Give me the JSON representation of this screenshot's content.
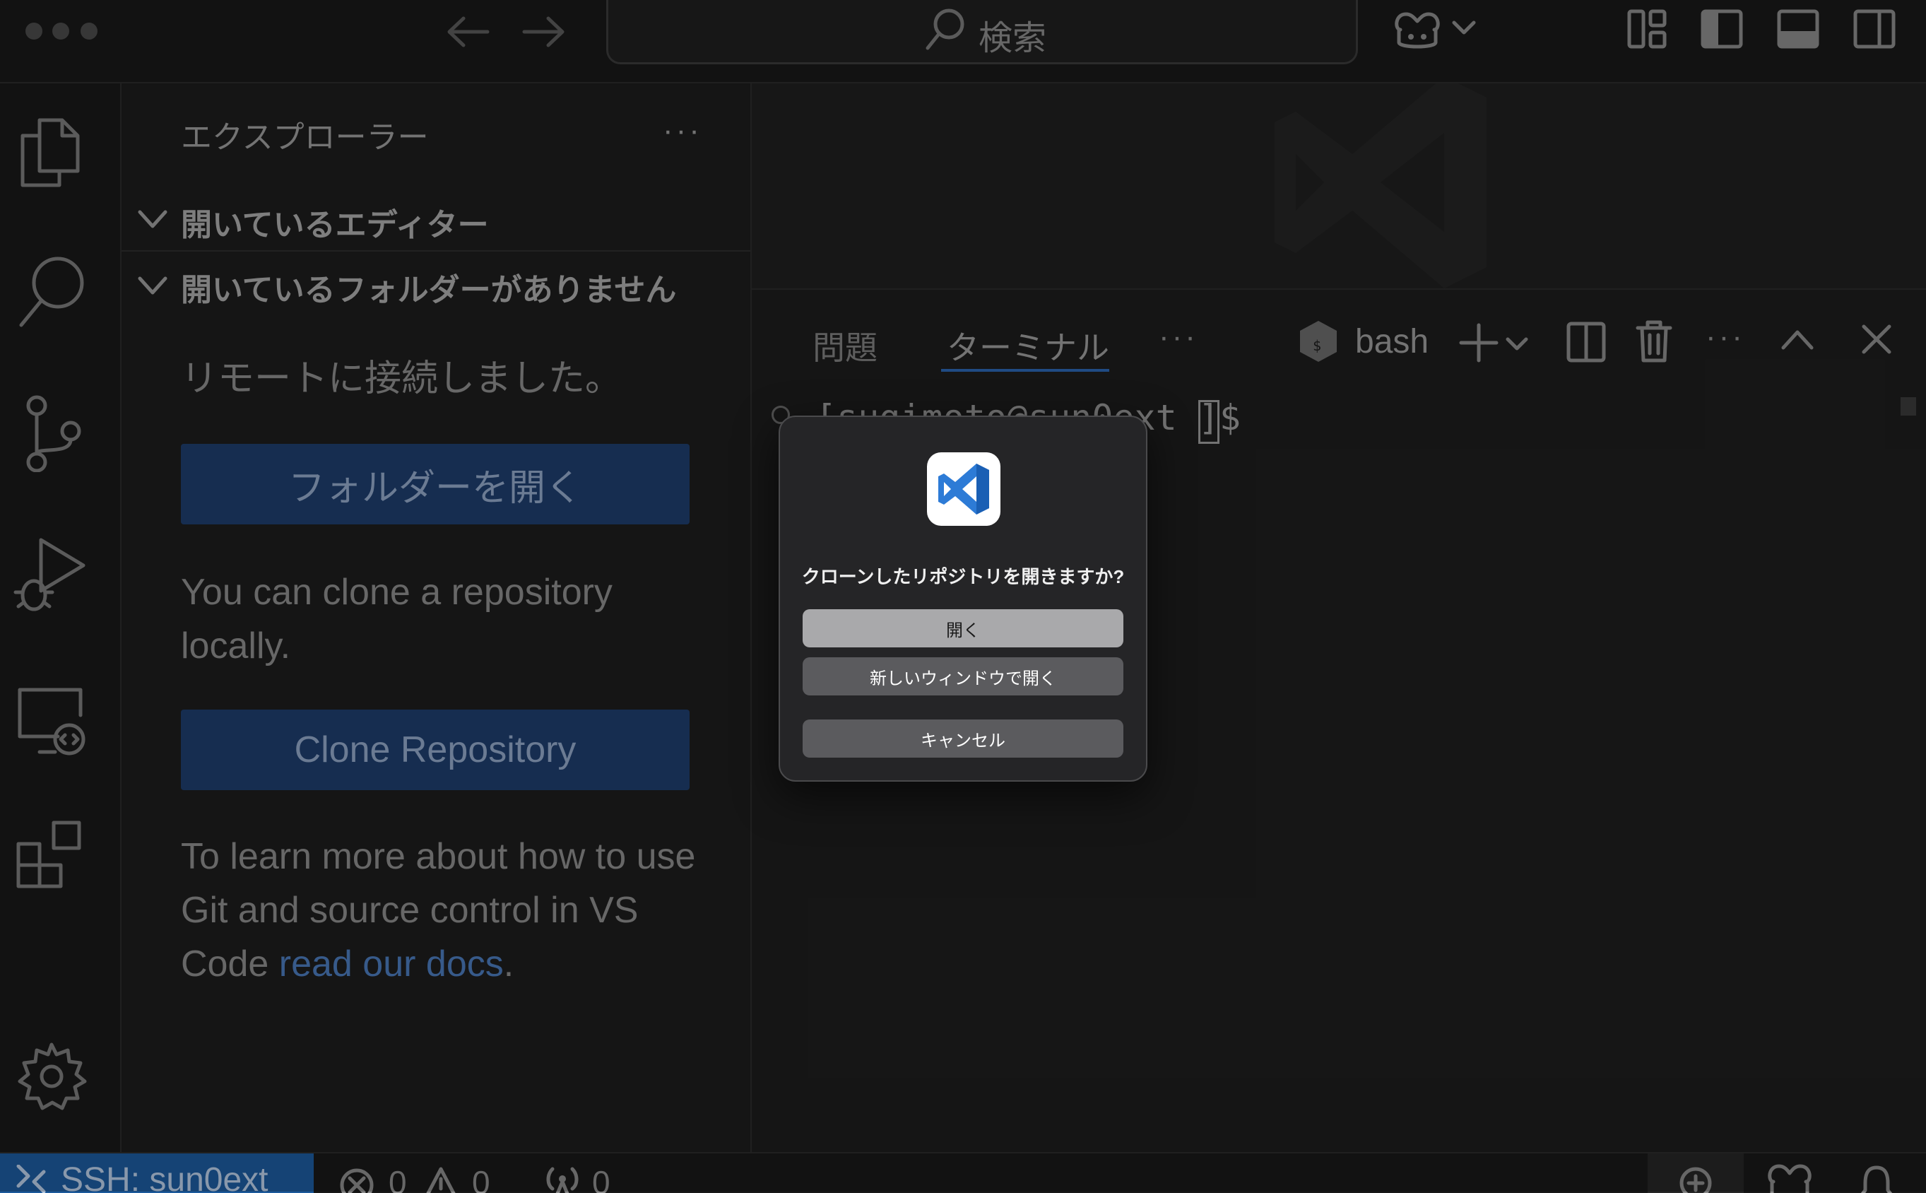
{
  "titlebar": {
    "search_text": "検索"
  },
  "sidebar": {
    "title": "エクスプローラー",
    "open_editors": "開いているエディター",
    "no_folder": "開いているフォルダーがありません",
    "remote_connected": "リモートに接続しました。",
    "open_folder_label": "フォルダーを開く",
    "clone_text": "You can clone a repository locally.",
    "clone_label": "Clone Repository",
    "learn_prefix": "To learn more about how to use Git and source control in VS Code ",
    "learn_link": "read our docs",
    "learn_suffix": "."
  },
  "panel": {
    "tabs": [
      "問題",
      "ターミナル"
    ],
    "shell": "bash",
    "prompt_partial": "[sugimoto@sun0ext ]$"
  },
  "dialog": {
    "title": "クローンしたリポジトリを開きますか?",
    "open": "開く",
    "open_new_window": "新しいウィンドウで開く",
    "cancel": "キャンセル"
  },
  "status": {
    "remote": "SSH: sun0ext",
    "errors": "0",
    "warnings": "0",
    "ports": "0"
  },
  "colors": {
    "accent": "#1c5a9c",
    "button": "#1e3d6b",
    "link": "#4a78b8"
  }
}
